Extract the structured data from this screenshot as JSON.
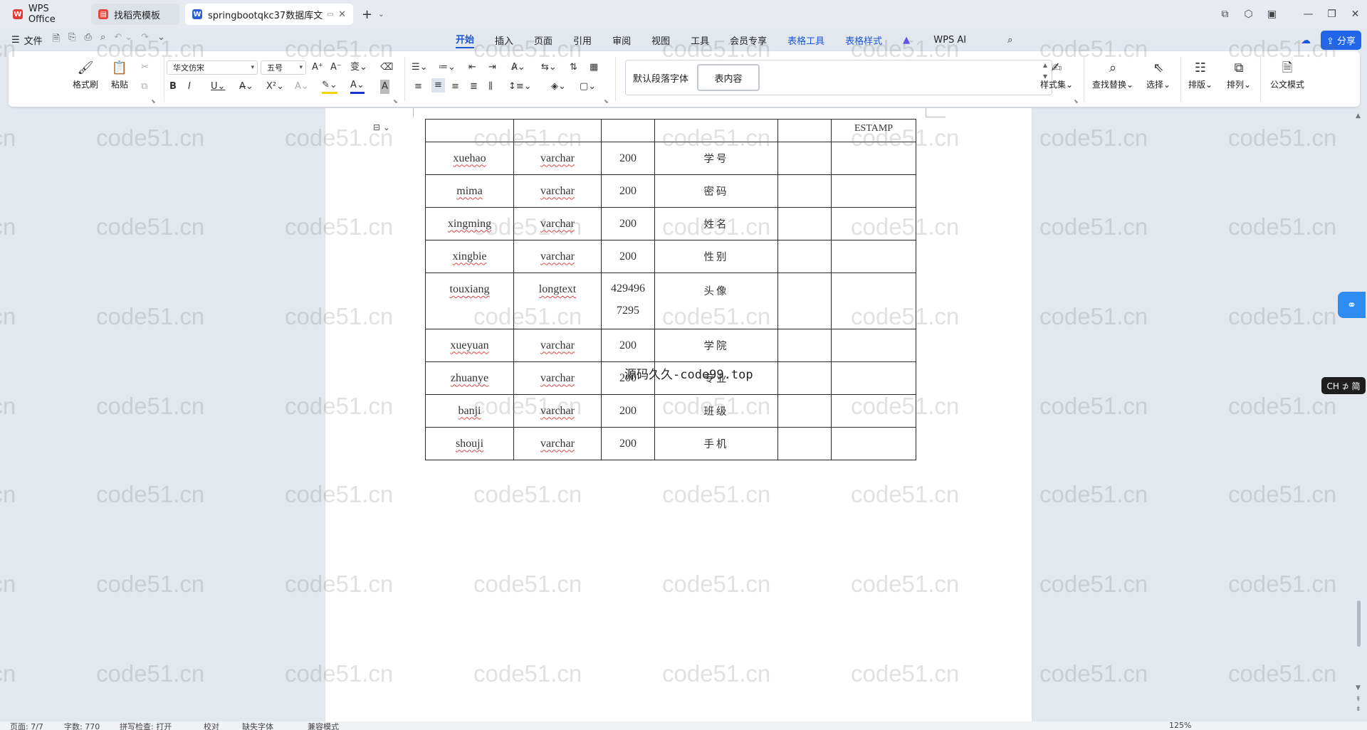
{
  "tabs": [
    {
      "label": "WPS Office",
      "icon": "wps-logo-icon"
    },
    {
      "label": "找稻壳模板",
      "icon": "docer-icon"
    },
    {
      "label": "springbootqkc37数据库文",
      "icon": "word-doc-icon"
    }
  ],
  "menu": {
    "file": "文件",
    "tabs": [
      "开始",
      "插入",
      "页面",
      "引用",
      "审阅",
      "视图",
      "工具",
      "会员专享",
      "表格工具",
      "表格样式"
    ],
    "wps_ai": "WPS AI",
    "share": "分享"
  },
  "ribbon": {
    "format_painter": "格式刷",
    "paste": "粘贴",
    "font_name": "华文仿宋",
    "font_size": "五号",
    "style_default": "默认段落字体",
    "style_table": "表内容",
    "style_set": "样式集",
    "find_replace": "查找替换",
    "select": "选择",
    "layout": "排版",
    "arrange": "排列",
    "official": "公文模式"
  },
  "table": {
    "top_row": [
      "",
      "",
      "",
      "",
      "",
      "ESTAMP"
    ],
    "rows": [
      {
        "name": "xuehao",
        "type": "varchar",
        "len": [
          "200"
        ],
        "comment": "学号"
      },
      {
        "name": "mima",
        "type": "varchar",
        "len": [
          "200"
        ],
        "comment": "密码"
      },
      {
        "name": "xingming",
        "type": "varchar",
        "len": [
          "200"
        ],
        "comment": "姓名"
      },
      {
        "name": "xingbie",
        "type": "varchar",
        "len": [
          "200"
        ],
        "comment": "性别"
      },
      {
        "name": "touxiang",
        "type": "longtext",
        "len": [
          "429496",
          "7295"
        ],
        "comment": "头像"
      },
      {
        "name": "xueyuan",
        "type": "varchar",
        "len": [
          "200"
        ],
        "comment": "学院"
      },
      {
        "name": "zhuanye",
        "type": "varchar",
        "len": [
          "200"
        ],
        "comment": "专业"
      },
      {
        "name": "banji",
        "type": "varchar",
        "len": [
          "200"
        ],
        "comment": "班级"
      },
      {
        "name": "shouji",
        "type": "varchar",
        "len": [
          "200"
        ],
        "comment": "手机"
      }
    ]
  },
  "overlay_text": "源码久久-code99.top",
  "watermark": "code51.cn",
  "ime": "CH ⊅ 简",
  "status": [
    "页面: 7/7",
    "字数: 770",
    "拼写检查: 打开",
    "校对",
    "缺失字体",
    "兼容模式",
    "125%"
  ]
}
